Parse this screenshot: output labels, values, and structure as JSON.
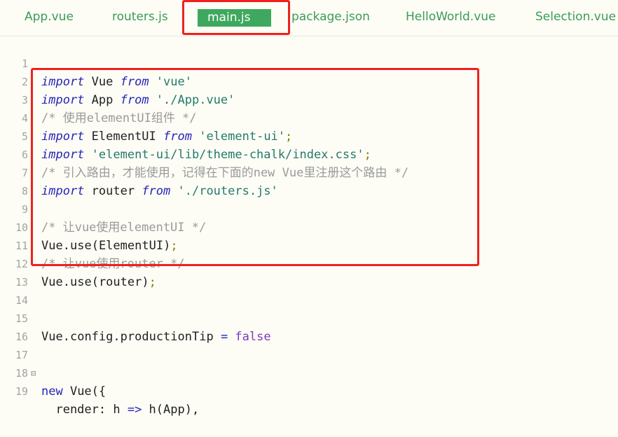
{
  "tabs": [
    {
      "label": "App.vue"
    },
    {
      "label": "routers.js"
    },
    {
      "label": "main.js"
    },
    {
      "label": "package.json"
    },
    {
      "label": "HelloWorld.vue"
    },
    {
      "label": "Selection.vue"
    }
  ],
  "active_tab": "main.js",
  "colors": {
    "highlight_box": "#f0201e",
    "active_tab_bg": "#3fa85f",
    "tab_text": "#3a9b57"
  },
  "code": {
    "line_numbers": [
      "1",
      "2",
      "3",
      "4",
      "5",
      "6",
      "7",
      "8",
      "9",
      "10",
      "11",
      "12",
      "13",
      "14",
      "15",
      "16",
      "17",
      "18",
      "19"
    ],
    "l1": {
      "a": "import",
      "b": " Vue ",
      "c": "from",
      "d": " 'vue'"
    },
    "l2": {
      "a": "import",
      "b": " App ",
      "c": "from",
      "d": " './App.vue'"
    },
    "l3": {
      "t": "/* 使用elementUI组件 */"
    },
    "l4": {
      "a": "import",
      "b": " ElementUI ",
      "c": "from",
      "d": " 'element-ui'",
      "e": ";"
    },
    "l5": {
      "a": "import",
      "d": " 'element-ui/lib/theme-chalk/index.css'",
      "e": ";"
    },
    "l6": {
      "t": "/* 引入路由，才能使用，记得在下面的new Vue里注册这个路由 */"
    },
    "l7": {
      "a": "import",
      "b": " router ",
      "c": "from",
      "d": " './routers.js'"
    },
    "l9": {
      "t": "/* 让vue使用elementUI */"
    },
    "l10": {
      "b": "Vue",
      "p1": ".",
      "m": "use",
      "p2": "(",
      "arg": "ElementUI",
      "p3": ")",
      "e": ";"
    },
    "l11": {
      "t": "/* 让vue使用router */"
    },
    "l12": {
      "b": "Vue",
      "p1": ".",
      "m": "use",
      "p2": "(",
      "arg": "router",
      "p3": ")",
      "e": ";"
    },
    "l15": {
      "b": "Vue",
      "p1": ".",
      "m": "config",
      "p2": ".",
      "arg": "productionTip",
      "op": " = ",
      "v": "false"
    },
    "l17": {
      "kw": "new",
      "b": " Vue",
      "p": "({"
    },
    "l19": {
      "b": "  render: h ",
      "op": "=>",
      "c": " h",
      "p": "(",
      "arg": "App",
      "q": "),"
    }
  }
}
